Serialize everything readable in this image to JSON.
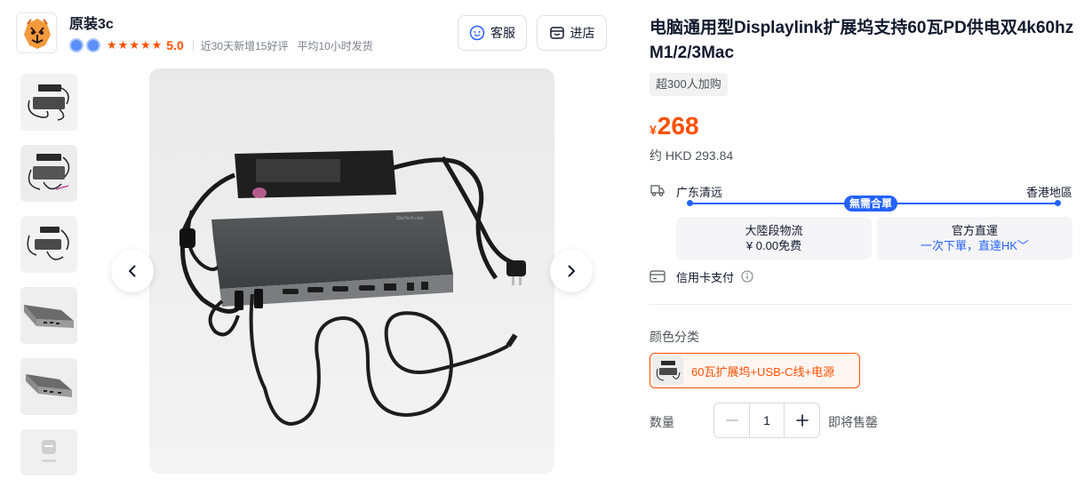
{
  "shop": {
    "name": "原装3c",
    "rating": "5.0",
    "new_reviews": "近30天新增15好评",
    "ship_time": "平均10小时发货",
    "service_label": "客服",
    "store_label": "进店"
  },
  "product": {
    "title": "电脑通用型Displaylink扩展坞支持60瓦PD供电双4k60hz M1/2/3Mac",
    "buy_tag": "超300人加购",
    "currency": "¥",
    "price": "268",
    "hkd_price": "约 HKD 293.84"
  },
  "shipping": {
    "from": "广东清远",
    "to": "香港地區",
    "badge": "無需合單",
    "option_left": {
      "title": "大陸段物流",
      "value": "¥ 0.00免费"
    },
    "option_right": {
      "title": "官方直運",
      "value": "一次下單，直達HK﹀"
    },
    "payment": "信用卡支付"
  },
  "sku": {
    "label": "颜色分类",
    "selected": "60瓦扩展坞+USB-C线+电源"
  },
  "quantity": {
    "label": "数量",
    "value": "1",
    "status": "即将售罄"
  },
  "colors": {
    "accent": "#ff5000",
    "link_blue": "#2462ff"
  },
  "icons": [
    "tiger-logo-icon",
    "member-badge-icon",
    "star-icon",
    "customer-service-icon",
    "store-icon",
    "truck-icon",
    "card-icon",
    "info-icon",
    "chevron-left-icon",
    "chevron-right-icon",
    "minus-icon",
    "plus-icon"
  ]
}
